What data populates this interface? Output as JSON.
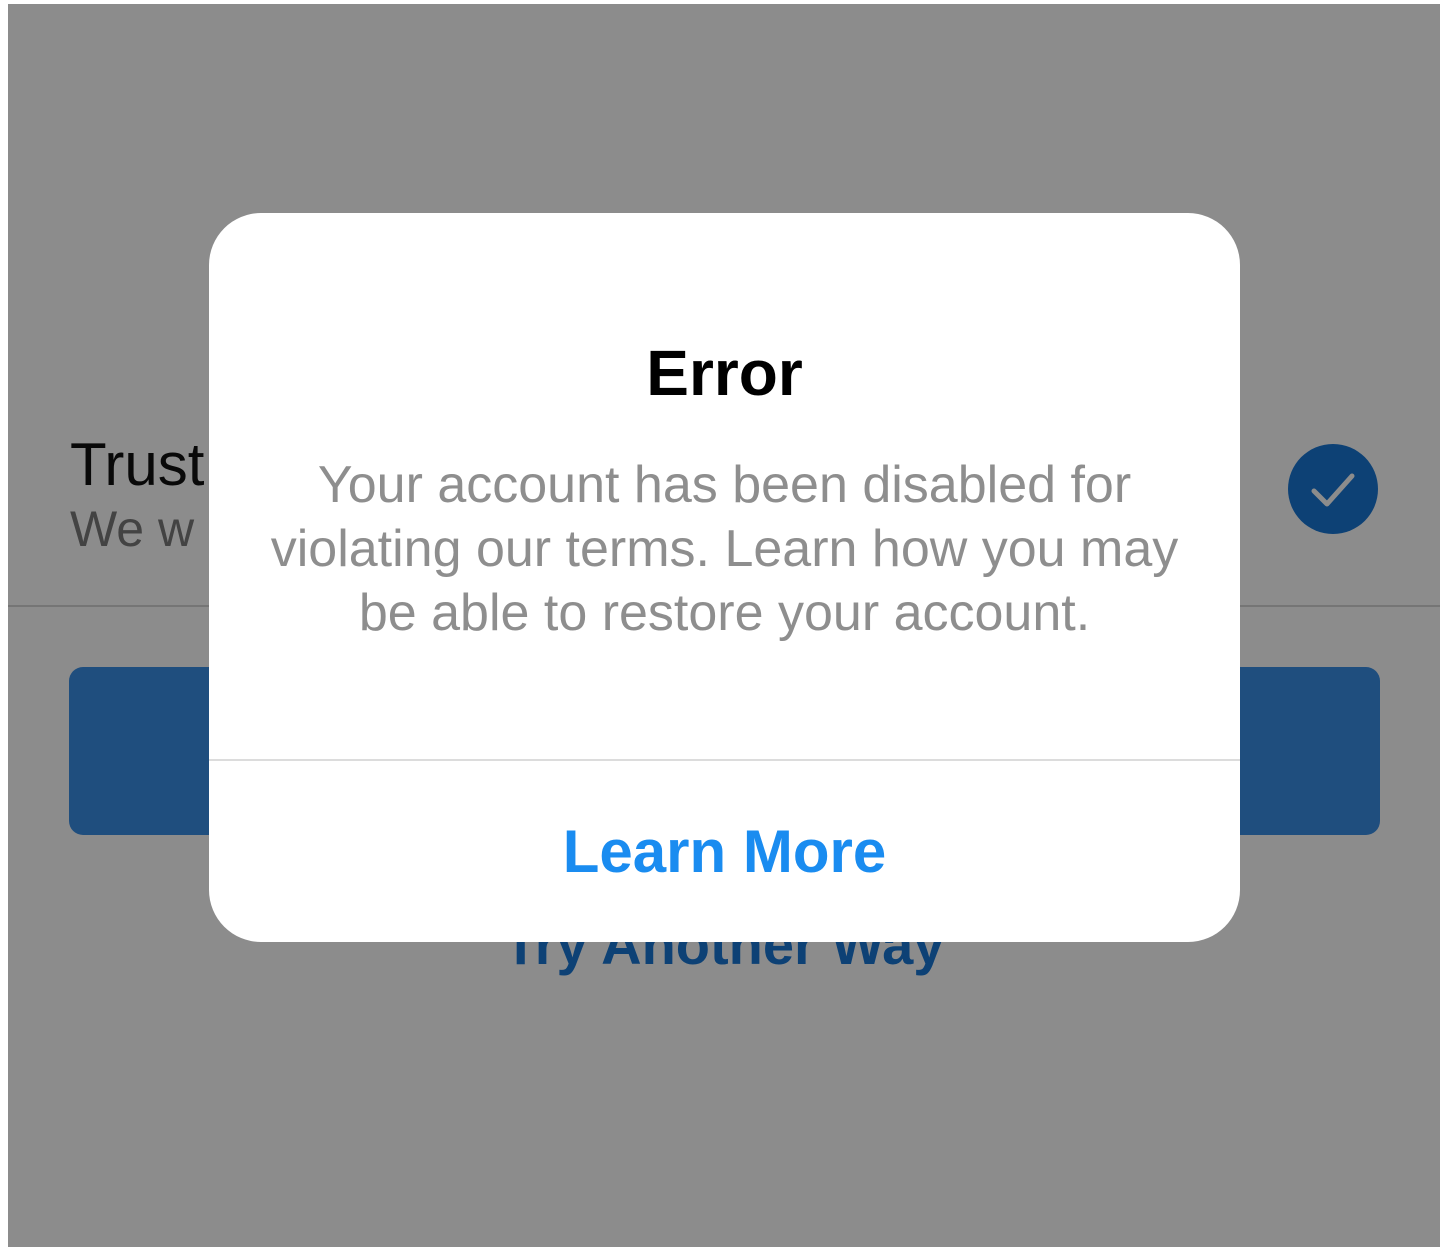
{
  "background": {
    "row_title": "Trust",
    "row_subtitle": "We w",
    "secondary_link": "Try Another Way"
  },
  "alert": {
    "title": "Error",
    "message": "Your account has been disabled for violating our terms. Learn how you may be able to restore your account.",
    "action_label": "Learn More"
  },
  "icons": {
    "selected_check": "checkmark-icon"
  },
  "colors": {
    "accent": "#1a8cf0",
    "check_background": "#1877d6",
    "primary_button": "#3a8ee6",
    "overlay": "#8a8a8a"
  }
}
